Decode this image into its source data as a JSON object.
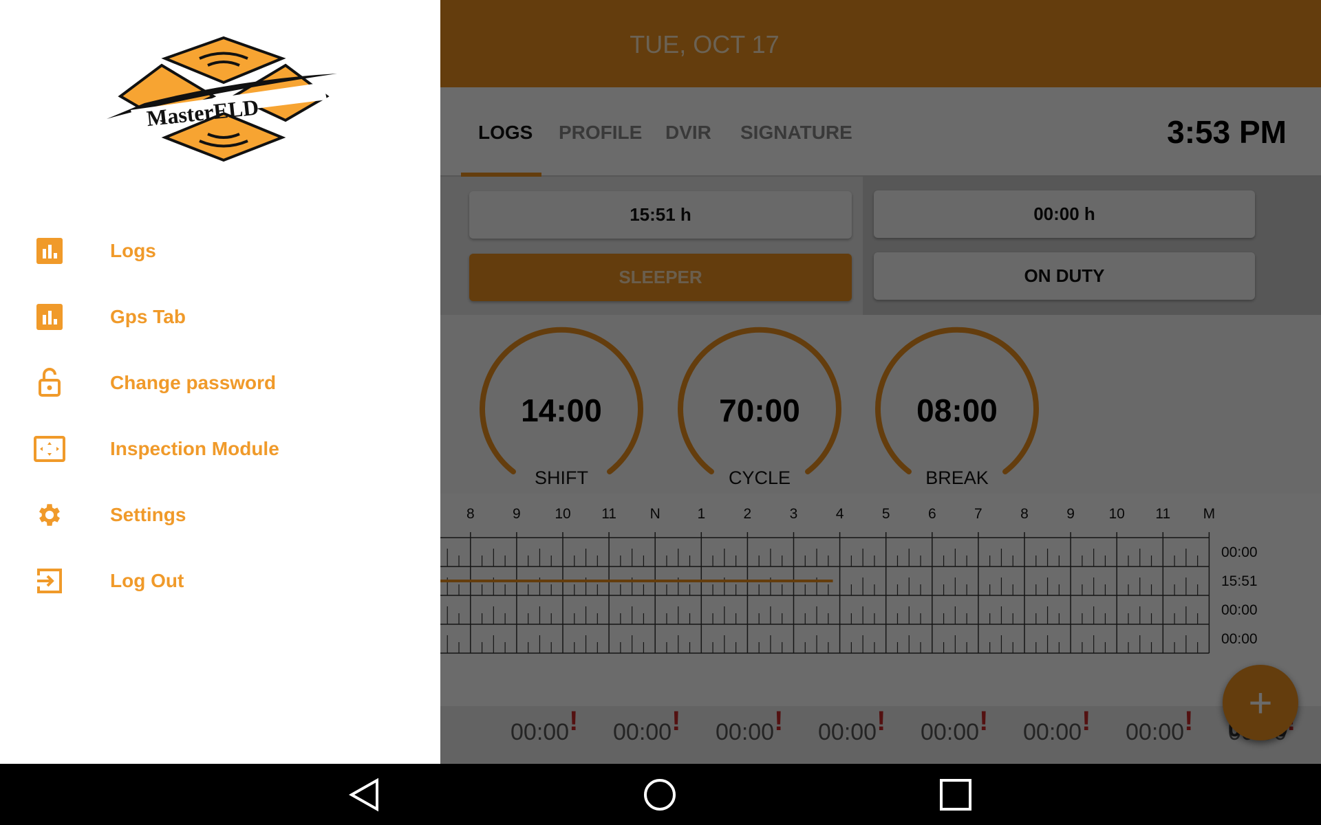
{
  "header": {
    "date": "TUE, OCT 17",
    "time": "3:53 PM"
  },
  "tabs": [
    {
      "label": "LOGS",
      "active": true
    },
    {
      "label": "PROFILE"
    },
    {
      "label": "DVIR"
    },
    {
      "label": "SIGNATURE"
    }
  ],
  "status": {
    "sleeper_hours": "15:51 h",
    "sleeper_label": "SLEEPER",
    "on_duty_hours": "00:00 h",
    "on_duty_label": "ON DUTY",
    "selected": "SLEEPER"
  },
  "gauges": [
    {
      "value": "14:00",
      "label": "SHIFT"
    },
    {
      "value": "70:00",
      "label": "CYCLE"
    },
    {
      "value": "08:00",
      "label": "BREAK"
    }
  ],
  "graph": {
    "hour_labels": [
      "8",
      "9",
      "10",
      "11",
      "N",
      "1",
      "2",
      "3",
      "4",
      "5",
      "6",
      "7",
      "8",
      "9",
      "10",
      "11",
      "M"
    ],
    "row_totals": [
      "00:00",
      "15:51",
      "00:00",
      "00:00"
    ],
    "sleeper_end_hours": 15.85
  },
  "bottom_values": [
    "00:00",
    "00:00",
    "00:00",
    "00:00",
    "00:00",
    "00:00",
    "00:00",
    "00:00",
    "00:00"
  ],
  "bottom_total": "00:00",
  "drawer": {
    "logo_text": "MasterELD",
    "items": [
      {
        "label": "Logs",
        "icon": "bar-chart-icon"
      },
      {
        "label": "Gps Tab",
        "icon": "bar-chart-icon"
      },
      {
        "label": "Change password",
        "icon": "lock-open-icon"
      },
      {
        "label": "Inspection Module",
        "icon": "screen-expand-icon"
      },
      {
        "label": "Settings",
        "icon": "gear-icon"
      },
      {
        "label": "Log Out",
        "icon": "logout-icon"
      }
    ]
  },
  "colors": {
    "accent": "#ef911f",
    "drawer_text": "#f09a2a",
    "alert": "#c62828"
  }
}
